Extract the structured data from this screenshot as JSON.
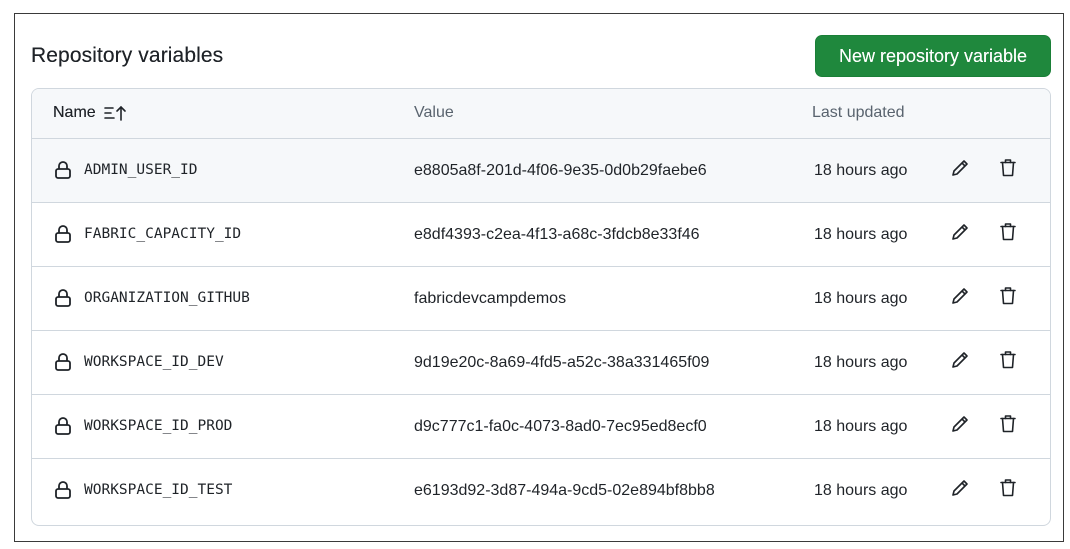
{
  "header": {
    "title": "Repository variables",
    "new_button_label": "New repository variable"
  },
  "table": {
    "columns": {
      "name": "Name",
      "value": "Value",
      "updated": "Last updated"
    },
    "sort_icon": "sort-ascending-icon",
    "rows": [
      {
        "name": "ADMIN_USER_ID",
        "value": "e8805a8f-201d-4f06-9e35-0d0b29faebe6",
        "updated": "18 hours ago"
      },
      {
        "name": "FABRIC_CAPACITY_ID",
        "value": "e8df4393-c2ea-4f13-a68c-3fdcb8e33f46",
        "updated": "18 hours ago"
      },
      {
        "name": "ORGANIZATION_GITHUB",
        "value": "fabricdevcampdemos",
        "updated": "18 hours ago"
      },
      {
        "name": "WORKSPACE_ID_DEV",
        "value": "9d19e20c-8a69-4fd5-a52c-38a331465f09",
        "updated": "18 hours ago"
      },
      {
        "name": "WORKSPACE_ID_PROD",
        "value": "d9c777c1-fa0c-4073-8ad0-7ec95ed8ecf0",
        "updated": "18 hours ago"
      },
      {
        "name": "WORKSPACE_ID_TEST",
        "value": "e6193d92-3d87-494a-9cd5-02e894bf8bb8",
        "updated": "18 hours ago"
      }
    ]
  },
  "colors": {
    "primary_button": "#1f883d",
    "border": "#d0d7de",
    "header_bg": "#f6f8fa",
    "text": "#1f2328",
    "muted": "#59636e"
  }
}
